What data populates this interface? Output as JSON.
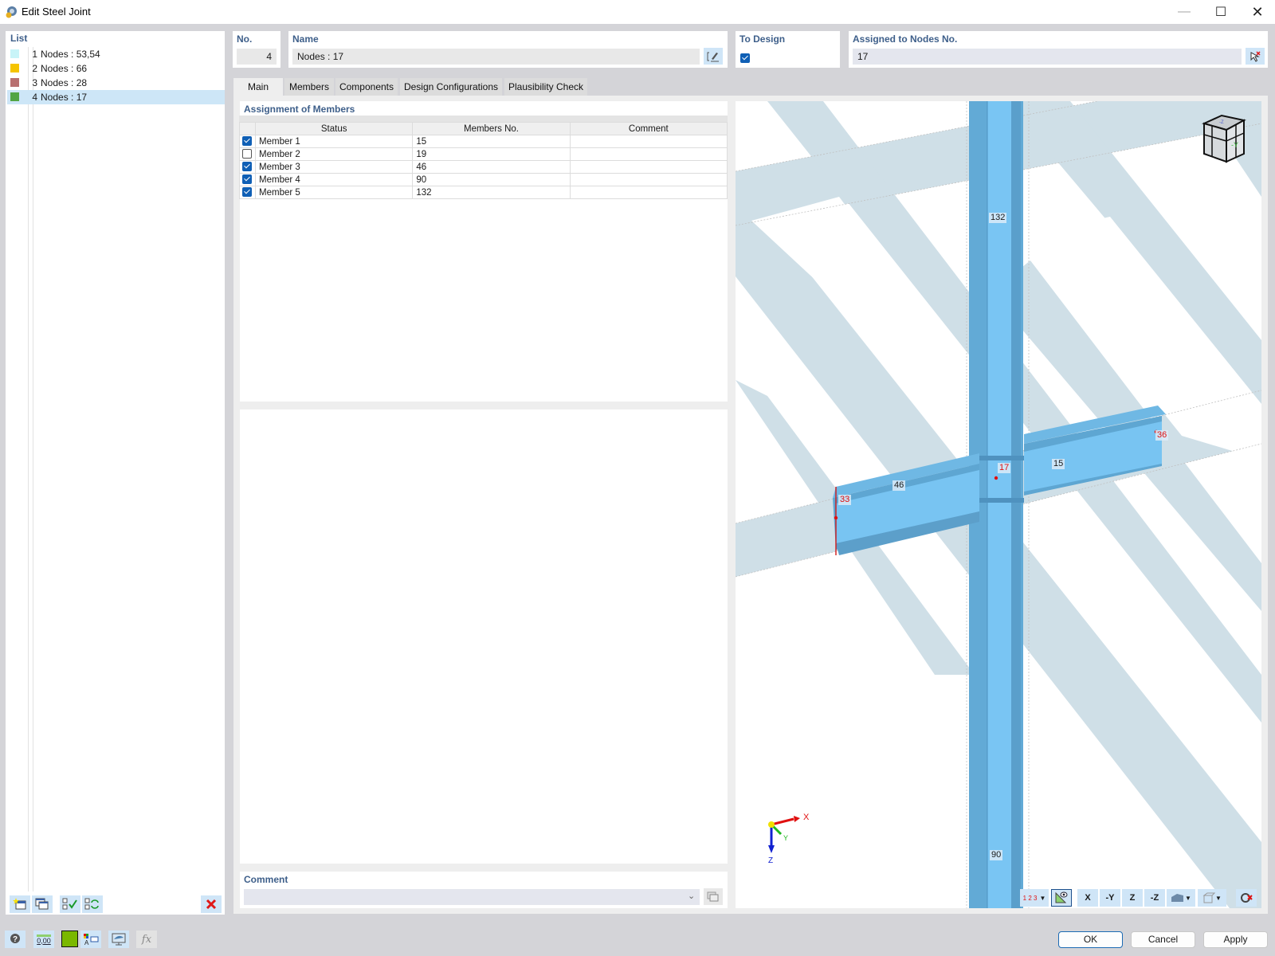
{
  "window": {
    "title": "Edit Steel Joint",
    "controls": [
      "minimize",
      "maximize",
      "close"
    ]
  },
  "list": {
    "header": "List",
    "items": [
      {
        "no": "1",
        "label": "Nodes : 53,54",
        "color": "#c8f4f8",
        "selected": false
      },
      {
        "no": "2",
        "label": "Nodes : 66",
        "color": "#f5c400",
        "selected": false
      },
      {
        "no": "3",
        "label": "Nodes : 28",
        "color": "#b87070",
        "selected": false
      },
      {
        "no": "4",
        "label": "Nodes : 17",
        "color": "#52a544",
        "selected": true
      }
    ]
  },
  "header": {
    "no_label": "No.",
    "no_value": "4",
    "name_label": "Name",
    "name_value": "Nodes : 17",
    "to_design_label": "To Design",
    "to_design_checked": true,
    "assigned_label": "Assigned to Nodes No.",
    "assigned_value": "17"
  },
  "tabs": [
    {
      "label": "Main",
      "active": true
    },
    {
      "label": "Members",
      "active": false
    },
    {
      "label": "Components",
      "active": false
    },
    {
      "label": "Design Configurations",
      "active": false
    },
    {
      "label": "Plausibility Check",
      "active": false
    }
  ],
  "assignment": {
    "title": "Assignment of Members",
    "columns": [
      "Status",
      "Members No.",
      "Comment"
    ],
    "rows": [
      {
        "checked": true,
        "status": "Member 1",
        "member_no": "15",
        "comment": ""
      },
      {
        "checked": false,
        "status": "Member 2",
        "member_no": "19",
        "comment": ""
      },
      {
        "checked": true,
        "status": "Member 3",
        "member_no": "46",
        "comment": ""
      },
      {
        "checked": true,
        "status": "Member 4",
        "member_no": "90",
        "comment": ""
      },
      {
        "checked": true,
        "status": "Member 5",
        "member_no": "132",
        "comment": ""
      }
    ]
  },
  "comment": {
    "label": "Comment",
    "value": ""
  },
  "viewport": {
    "member_labels": [
      "132",
      "46",
      "15",
      "90"
    ],
    "node_labels": [
      "17",
      "33",
      "36"
    ],
    "axes": {
      "x": "X",
      "y": "Y",
      "z": "Z"
    },
    "view_cube_faces": [
      "-Z",
      "-Y",
      "X"
    ],
    "toolbar_icons": [
      "numbering-icon",
      "visibility-icon",
      "view-x-icon",
      "view-minus-y-icon",
      "view-z-icon",
      "view-minus-z-icon",
      "render-mode-icon",
      "transparency-icon",
      "reset-view-icon"
    ],
    "toolbar_labels": [
      "X",
      "-Y",
      "Z",
      "-Z"
    ]
  },
  "list_toolbar": [
    "new-icon",
    "copy-icon",
    "check-all-icon",
    "toggle-check-icon",
    "delete-icon"
  ],
  "bottom_toolbar": {
    "units_label": "0,00",
    "color_swatch": "#7ab800"
  },
  "buttons": {
    "ok": "OK",
    "cancel": "Cancel",
    "apply": "Apply"
  }
}
